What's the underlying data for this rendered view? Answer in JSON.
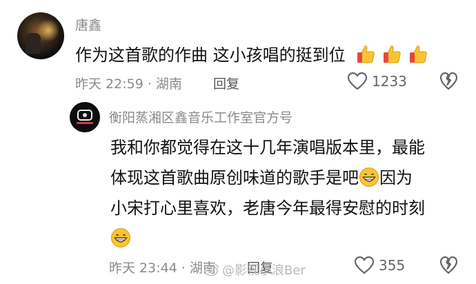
{
  "comment1": {
    "username": "唐鑫",
    "text": "作为这首歌的作曲 这小孩唱的挺到位",
    "emojis": [
      "thumbs-up",
      "thumbs-up",
      "thumbs-up"
    ],
    "time": "昨天 22:59",
    "location": "湖南",
    "reply_label": "回复",
    "like_count": "1233"
  },
  "reply1": {
    "username": "衡阳蒸湘区鑫音乐工作室官方号",
    "avatar_text": "MUSIC",
    "line1": "我和你都觉得在这十几年演唱版本里，最能",
    "line2_before_emoji": "体现这首歌曲原创味道的歌手是吧",
    "line2_after_emoji": "因为",
    "line3": "小宋打心里喜欢，老唐今年最得安慰的时刻",
    "time": "昨天 23:44",
    "location": "湖南",
    "reply_label": "回复",
    "like_count": "355"
  },
  "watermark": {
    "text": "@影视小浪Ber"
  },
  "colors": {
    "meta_gray": "#8a8a8a",
    "text": "#111111",
    "emoji_yellow": "#f7c531",
    "emoji_red": "#e9463b"
  }
}
